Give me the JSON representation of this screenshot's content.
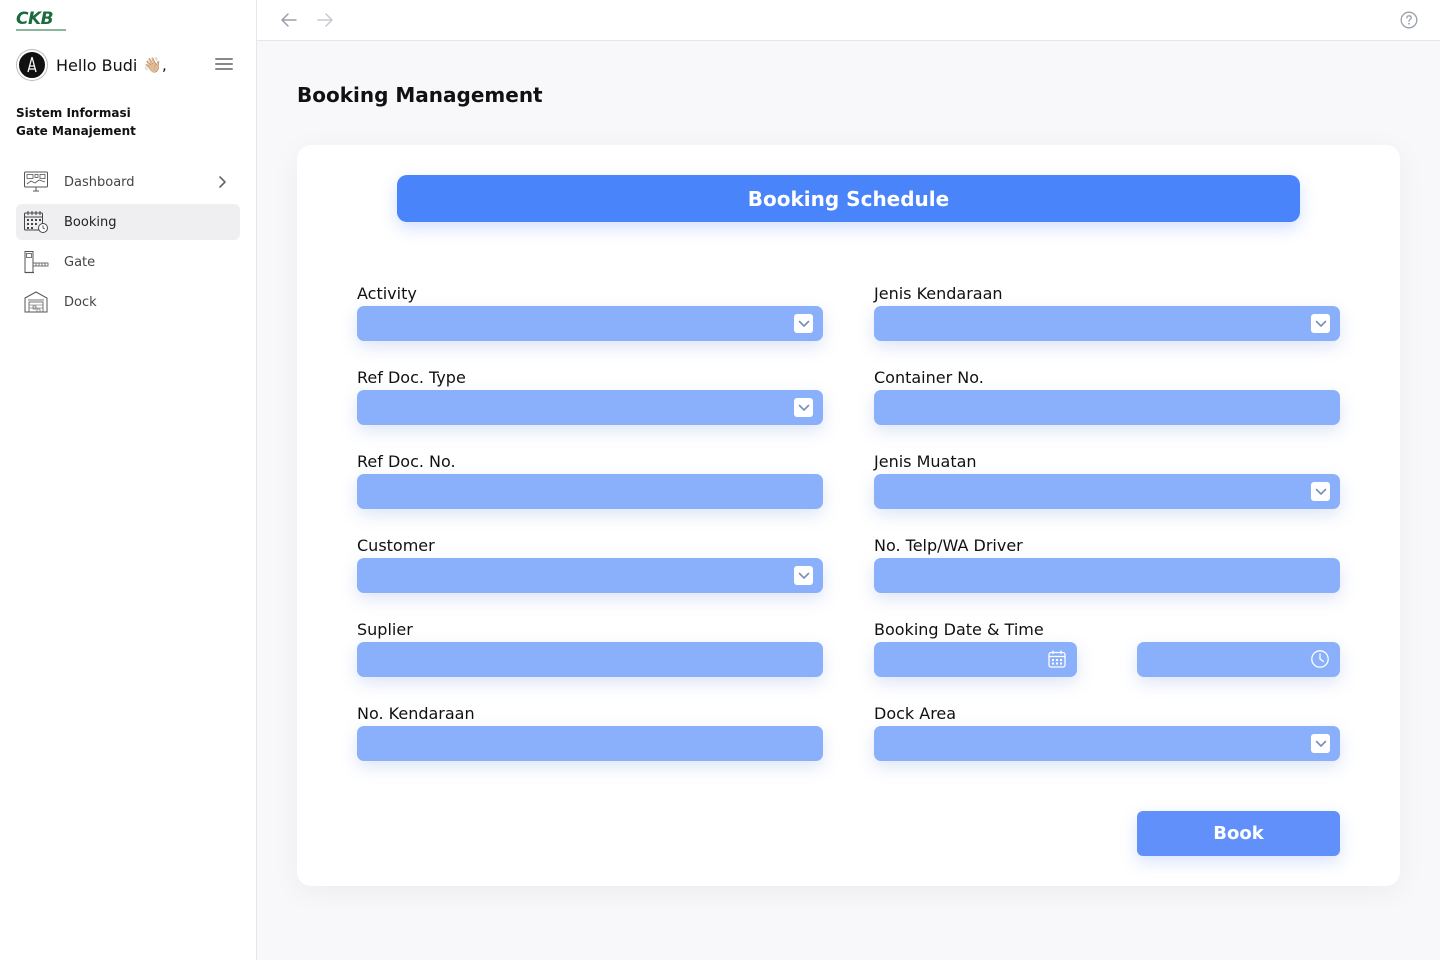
{
  "brand": {
    "logo_text": "CKB"
  },
  "user": {
    "greeting": "Hello Budi",
    "wave_emoji": "👋🏼,"
  },
  "sidebar": {
    "system_title_line1": "Sistem Informasi",
    "system_title_line2": "Gate Manajement",
    "items": [
      {
        "label": "Dashboard",
        "icon": "dashboard-icon",
        "active": false,
        "has_chevron": true
      },
      {
        "label": "Booking",
        "icon": "calendar-icon",
        "active": true,
        "has_chevron": false
      },
      {
        "label": "Gate",
        "icon": "gate-icon",
        "active": false,
        "has_chevron": false
      },
      {
        "label": "Dock",
        "icon": "warehouse-icon",
        "active": false,
        "has_chevron": false
      }
    ]
  },
  "topbar": {
    "back_icon": "arrow-left-icon",
    "forward_icon": "arrow-right-icon",
    "help_icon": "help-circle-icon"
  },
  "page": {
    "title": "Booking Management"
  },
  "form": {
    "banner": "Booking Schedule",
    "left": [
      {
        "label": "Activity",
        "type": "select",
        "value": ""
      },
      {
        "label": "Ref Doc. Type",
        "type": "select",
        "value": ""
      },
      {
        "label": "Ref Doc. No.",
        "type": "text",
        "value": ""
      },
      {
        "label": "Customer",
        "type": "select",
        "value": ""
      },
      {
        "label": "Suplier",
        "type": "text",
        "value": ""
      },
      {
        "label": "No. Kendaraan",
        "type": "text",
        "value": ""
      }
    ],
    "right": [
      {
        "label": "Jenis Kendaraan",
        "type": "select",
        "value": ""
      },
      {
        "label": "Container No.",
        "type": "text",
        "value": ""
      },
      {
        "label": "Jenis Muatan",
        "type": "select",
        "value": ""
      },
      {
        "label": "No. Telp/WA Driver",
        "type": "text",
        "value": ""
      },
      {
        "label": "Booking Date & Time",
        "type": "datetime",
        "date_value": "",
        "time_value": ""
      },
      {
        "label": "Dock Area",
        "type": "select",
        "value": ""
      }
    ],
    "submit_label": "Book"
  },
  "colors": {
    "accent": "#4a84fb",
    "field_bg": "#8aaffb",
    "button": "#6190fb",
    "brand_green": "#1b6b3f"
  }
}
